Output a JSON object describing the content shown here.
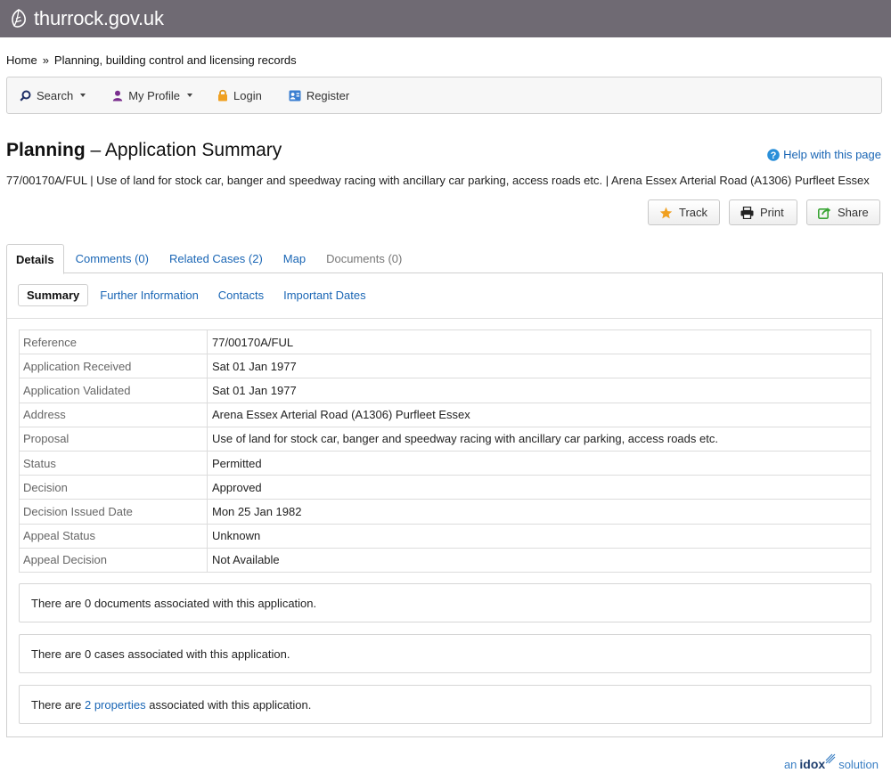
{
  "header": {
    "site_name": "thurrock.gov.uk"
  },
  "breadcrumb": {
    "home": "Home",
    "separator": "»",
    "current": "Planning, building control and licensing records"
  },
  "nav": {
    "search": "Search",
    "my_profile": "My Profile",
    "login": "Login",
    "register": "Register"
  },
  "page": {
    "title_bold": "Planning",
    "title_rest": " – Application Summary",
    "help": "Help with this page",
    "description": "77/00170A/FUL | Use of land for stock car, banger and speedway racing with ancillary car parking, access roads etc. | Arena Essex Arterial Road (A1306) Purfleet Essex"
  },
  "actions": {
    "track": "Track",
    "print": "Print",
    "share": "Share"
  },
  "tabs": {
    "details": "Details",
    "comments": "Comments (0)",
    "related_cases": "Related Cases (2)",
    "map": "Map",
    "documents": "Documents (0)"
  },
  "subtabs": {
    "summary": "Summary",
    "further_information": "Further Information",
    "contacts": "Contacts",
    "important_dates": "Important Dates"
  },
  "summary": {
    "rows": [
      {
        "label": "Reference",
        "value": "77/00170A/FUL"
      },
      {
        "label": "Application Received",
        "value": "Sat 01 Jan 1977"
      },
      {
        "label": "Application Validated",
        "value": "Sat 01 Jan 1977"
      },
      {
        "label": "Address",
        "value": "Arena Essex Arterial Road (A1306) Purfleet Essex"
      },
      {
        "label": "Proposal",
        "value": "Use of land for stock car, banger and speedway racing with ancillary car parking, access roads etc."
      },
      {
        "label": "Status",
        "value": "Permitted"
      },
      {
        "label": "Decision",
        "value": "Approved"
      },
      {
        "label": "Decision Issued Date",
        "value": "Mon 25 Jan 1982"
      },
      {
        "label": "Appeal Status",
        "value": "Unknown"
      },
      {
        "label": "Appeal Decision",
        "value": "Not Available"
      }
    ]
  },
  "info": {
    "documents": "There are 0 documents associated with this application.",
    "cases": "There are 0 cases associated with this application.",
    "properties_prefix": "There are ",
    "properties_link": "2 properties",
    "properties_suffix": " associated with this application."
  },
  "footer": {
    "prefix": "an",
    "brand": "idox",
    "suffix": "solution"
  },
  "colors": {
    "header_bg": "#6f6a73",
    "link": "#1a66b5",
    "star": "#f0a020",
    "share_icon": "#3aa535"
  }
}
